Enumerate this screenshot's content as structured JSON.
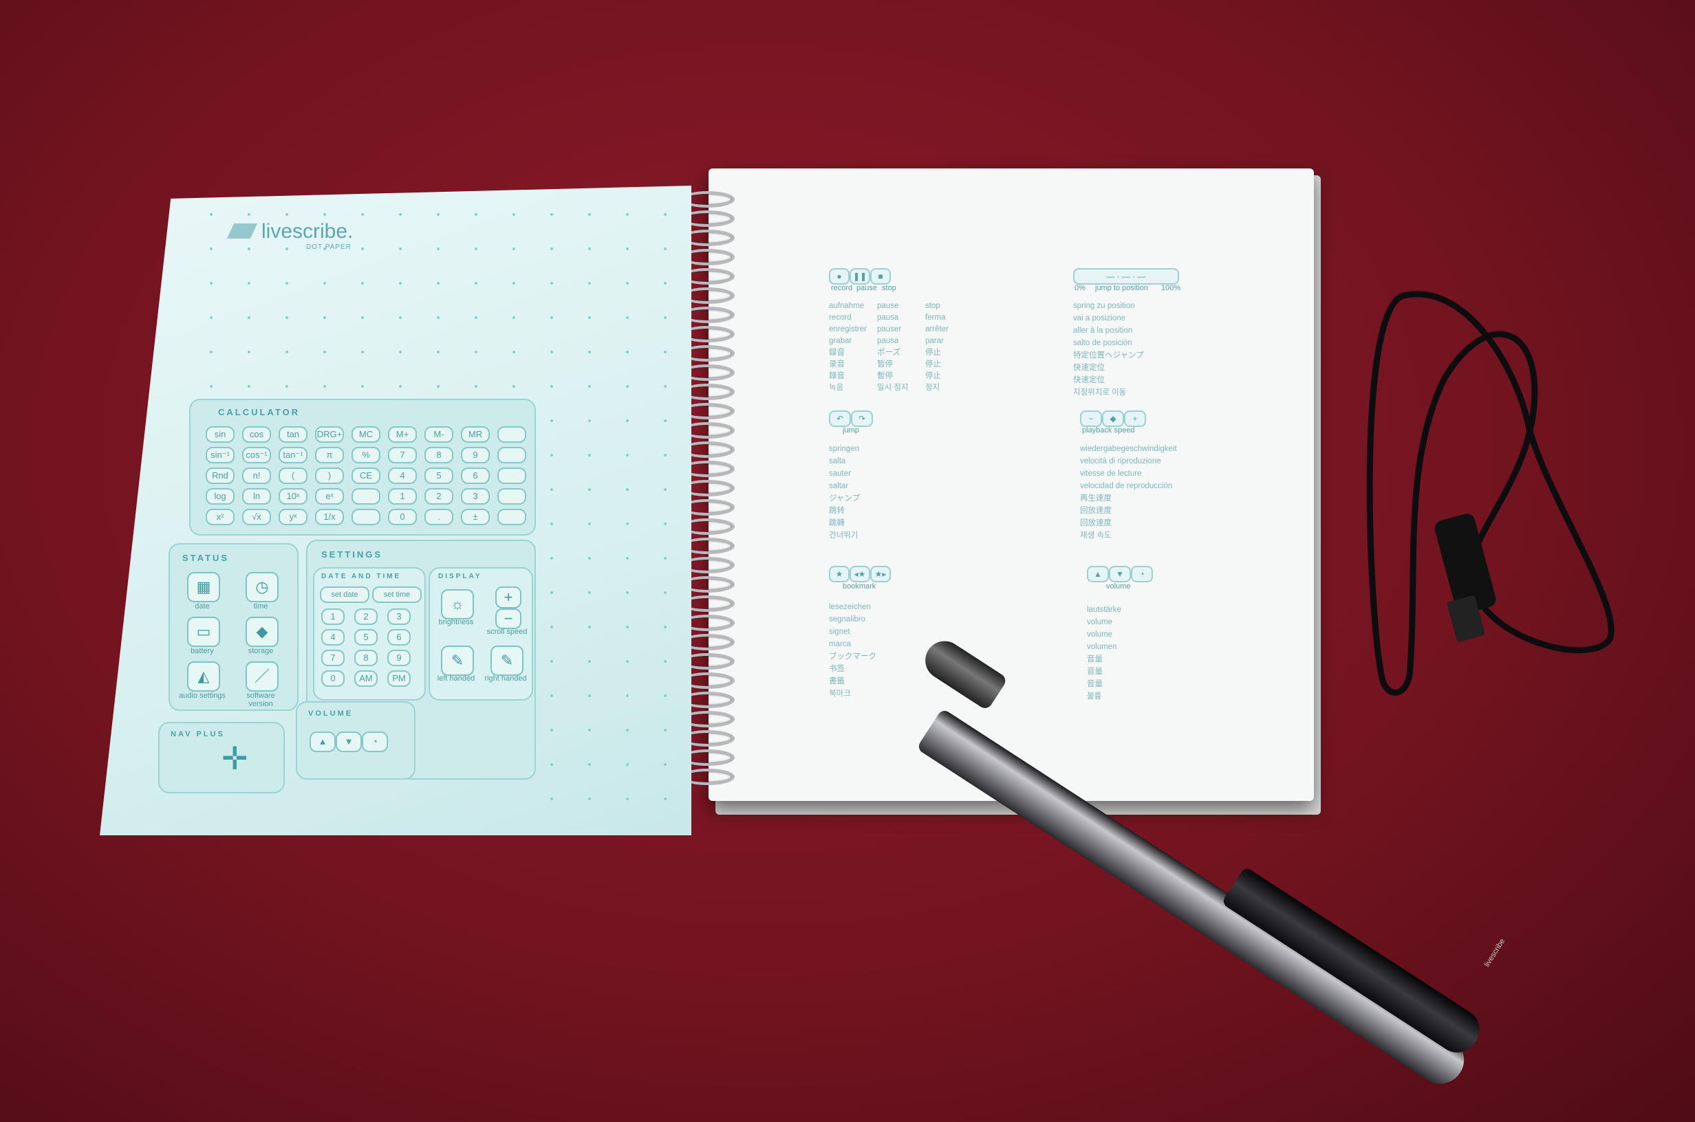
{
  "brand": {
    "name": "livescribe.",
    "subtitle": "DOT PAPER"
  },
  "calculator": {
    "title": "CALCULATOR",
    "rows": [
      [
        "sin",
        "cos",
        "tan",
        "DRG+",
        "MC",
        "M+",
        "M-",
        "MR",
        ""
      ],
      [
        "sin⁻¹",
        "cos⁻¹",
        "tan⁻¹",
        "π",
        "%",
        "7",
        "8",
        "9",
        ""
      ],
      [
        "Rnd",
        "n!",
        "(",
        ")",
        "CE",
        "4",
        "5",
        "6",
        ""
      ],
      [
        "log",
        "ln",
        "10ˣ",
        "eˣ",
        "",
        "1",
        "2",
        "3",
        ""
      ],
      [
        "x²",
        "√x",
        "yˣ",
        "1/x",
        "",
        "0",
        ".",
        "±",
        ""
      ]
    ]
  },
  "status": {
    "title": "STATUS",
    "items": [
      "date",
      "time",
      "battery",
      "storage",
      "audio settings",
      "software version"
    ]
  },
  "settings": {
    "title": "SETTINGS",
    "date_time_title": "DATE AND TIME",
    "set_date": "set date",
    "set_time": "set time",
    "keys": [
      "1",
      "2",
      "3",
      "4",
      "5",
      "6",
      "7",
      "8",
      "9",
      "0",
      "AM",
      "PM"
    ]
  },
  "display": {
    "title": "DISPLAY",
    "items": [
      "brightness",
      "scroll speed",
      "left handed",
      "right handed"
    ]
  },
  "volume_left": {
    "title": "VOLUME"
  },
  "nav_plus": {
    "title": "NAV PLUS"
  },
  "right_page": {
    "record_labels": [
      "record",
      "pause",
      "stop"
    ],
    "record_words": [
      [
        "aufnahme",
        "pause",
        "stop"
      ],
      [
        "record",
        "pausa",
        "ferma"
      ],
      [
        "enregistrer",
        "pauser",
        "arrêter"
      ],
      [
        "grabar",
        "pausa",
        "parar"
      ],
      [
        "録音",
        "ポーズ",
        "停止"
      ],
      [
        "录音",
        "暂停",
        "停止"
      ],
      [
        "錄音",
        "暫停",
        "停止"
      ],
      [
        "녹음",
        "일시 정지",
        "정지"
      ]
    ],
    "jump_pos_labels": [
      "0%",
      "jump to position",
      "100%"
    ],
    "jump_pos_words": [
      "spring zu position",
      "vai a posizione",
      "aller à la position",
      "salto de posición",
      "特定位置へジャンプ",
      "快速定位",
      "快速定位",
      "지정위치로 이동"
    ],
    "jump_label": "jump",
    "jump_words": [
      "springen",
      "salta",
      "sauter",
      "saltar",
      "ジャンプ",
      "跳转",
      "跳轉",
      "건너뛰기"
    ],
    "playback_label": "playback speed",
    "playback_words": [
      "wiedergabegeschwindigkeit",
      "velocità di riproduzione",
      "vitesse de lecture",
      "velocidad de reproducción",
      "再生速度",
      "回放速度",
      "回放速度",
      "재생 속도"
    ],
    "bookmark_label": "bookmark",
    "bookmark_words": [
      "lesezeichen",
      "segnalibro",
      "signet",
      "marca",
      "ブックマーク",
      "书签",
      "書籤",
      "북마크"
    ],
    "volume_label": "volume",
    "volume_words": [
      "lautstärke",
      "volume",
      "volume",
      "volumen",
      "音量",
      "音量",
      "音量",
      "볼륨"
    ]
  },
  "pen": {
    "logo": "livescribe"
  },
  "colors": {
    "table": "#7a1522",
    "page_teal": "#d8f0f0",
    "ink": "#4aa0a6"
  }
}
